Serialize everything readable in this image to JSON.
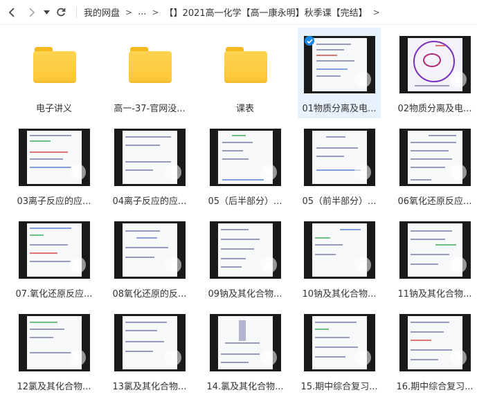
{
  "toolbar": {
    "back_icon": "chevron-left-icon",
    "forward_icon": "chevron-right-icon",
    "history_icon": "caret-down-icon",
    "refresh_icon": "refresh-icon",
    "breadcrumb": [
      "我的网盘",
      "...",
      "【】2021高一化学【高一康永明】秋季课【完结】"
    ],
    "separator": ">"
  },
  "colors": {
    "accent": "#1e88e5",
    "folder": "#fbc634",
    "selected_bg": "#e8f2fc"
  },
  "items": [
    {
      "type": "folder",
      "name": "电子讲义"
    },
    {
      "type": "folder",
      "name": "高一-37-官网没..."
    },
    {
      "type": "folder",
      "name": "课表"
    },
    {
      "type": "video",
      "name": "01物质分离及电...",
      "selected": true
    },
    {
      "type": "video",
      "name": "02物质分离及电..."
    },
    {
      "type": "video",
      "name": "03离子反应的应..."
    },
    {
      "type": "video",
      "name": "04离子反应的应..."
    },
    {
      "type": "video",
      "name": "05（后半部分）..."
    },
    {
      "type": "video",
      "name": "05（前半部分）..."
    },
    {
      "type": "video",
      "name": "06氧化还原反应..."
    },
    {
      "type": "video",
      "name": "07.氧化还原反应..."
    },
    {
      "type": "video",
      "name": "08氧化还原的反..."
    },
    {
      "type": "video",
      "name": "09钠及其化合物..."
    },
    {
      "type": "video",
      "name": "10钠及其化合物..."
    },
    {
      "type": "video",
      "name": "11钠及其化合物..."
    },
    {
      "type": "video",
      "name": "12氯及其化合物..."
    },
    {
      "type": "video",
      "name": "13氯及其化合物..."
    },
    {
      "type": "video",
      "name": "14.氯及其化合物..."
    },
    {
      "type": "video",
      "name": "15.期中综合复习..."
    },
    {
      "type": "video",
      "name": "16.期中综合复习..."
    }
  ]
}
